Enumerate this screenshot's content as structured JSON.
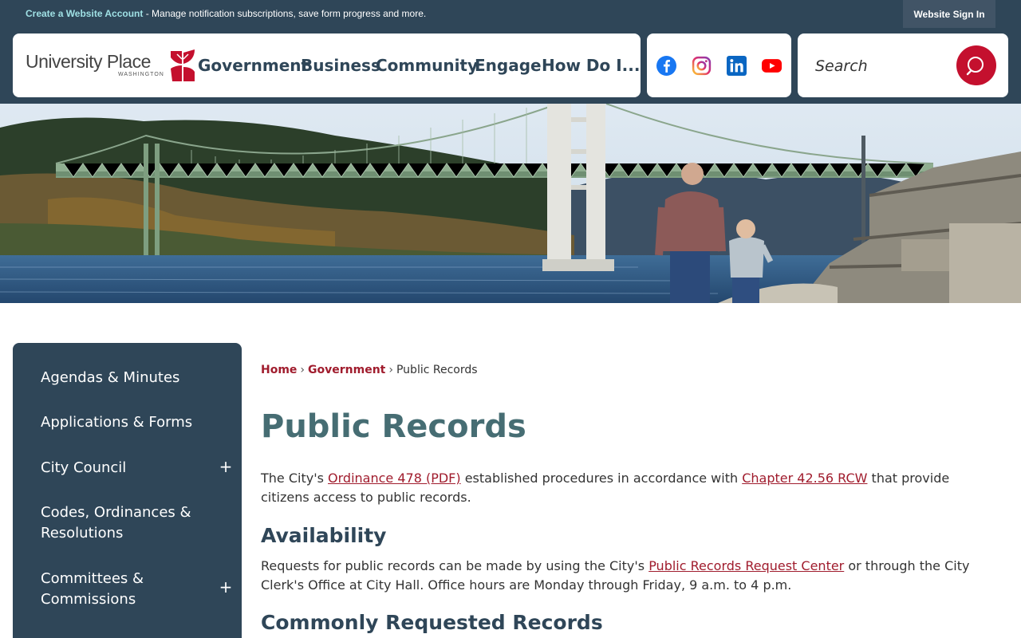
{
  "topbar": {
    "account_link": "Create a Website Account",
    "message": " - Manage notification subscriptions, save form progress and more.",
    "signin_label": "Website Sign In"
  },
  "logo": {
    "name": "University Place",
    "state": "WASHINGTON"
  },
  "nav": {
    "items": [
      "Government",
      "Business",
      "Community",
      "Engage",
      "How Do I..."
    ]
  },
  "social": {
    "icons": [
      "facebook-icon",
      "instagram-icon",
      "linkedin-icon",
      "youtube-icon"
    ]
  },
  "search": {
    "placeholder": "Search"
  },
  "sidebar": {
    "items": [
      {
        "label": "Agendas & Minutes"
      },
      {
        "label": "Applications & Forms"
      },
      {
        "label": "City Council",
        "toggle": "+"
      },
      {
        "label": "Codes, Ordinances & Resolutions"
      },
      {
        "label": "Committees & Commissions",
        "toggle": "+"
      }
    ]
  },
  "breadcrumb": {
    "home": "Home",
    "government": "Government",
    "current": "Public Records",
    "sep": "›"
  },
  "main": {
    "title": "Public Records",
    "intro": {
      "t1": "The City's ",
      "link1": "Ordinance 478 (PDF)",
      "t2": " established procedures in accordance with ",
      "link2": "Chapter 42.56 RCW",
      "t3": " that provide citizens access to public records."
    },
    "availability_heading": "Availability",
    "availability": {
      "t1": "Requests for public records can be made by using the City's ",
      "link": "Public Records Request Center",
      "t2": " or through the City Clerk's Office at City Hall. Office hours are Monday through Friday, 9 a.m. to 4 p.m."
    },
    "common_heading": "Commonly Requested Records"
  },
  "colors": {
    "navy": "#2f4658",
    "accent_red": "#c4102e",
    "link_red": "#a01c2d",
    "title_teal": "#466d73"
  }
}
